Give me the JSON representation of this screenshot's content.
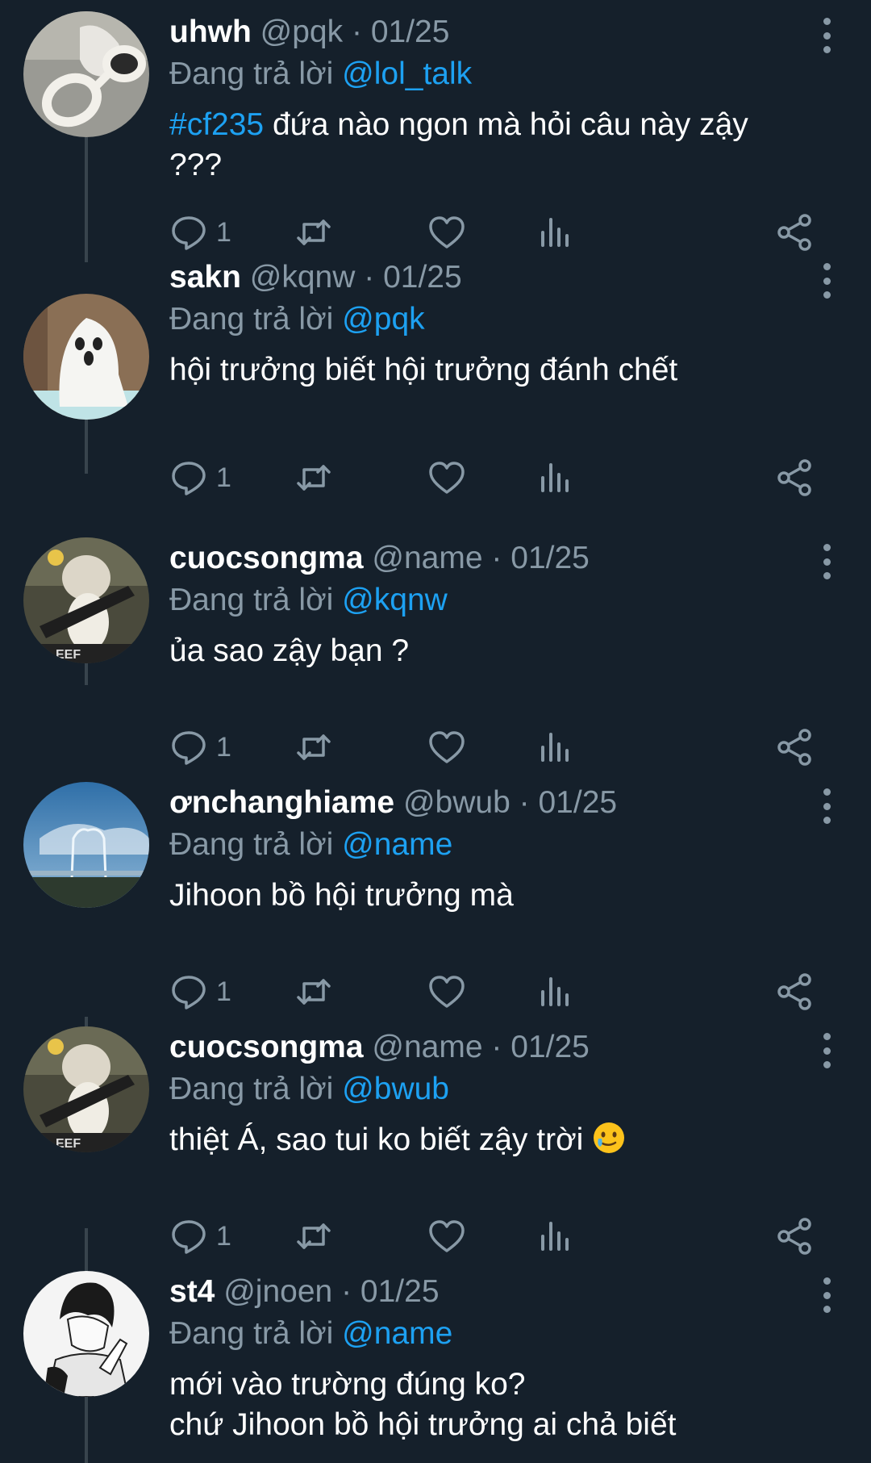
{
  "reply_prefix": "Đang trả lời",
  "separator": "·",
  "tweets": [
    {
      "name": "uhwh",
      "handle": "@pqk",
      "date": "01/25",
      "reply_to": "@lol_talk",
      "hashtag": "#cf235",
      "text": " đứa nào ngon mà hỏi câu này zậy ???",
      "reply_count": "1",
      "avatar": "glasses-avatar"
    },
    {
      "name": "sakn",
      "handle": "@kqnw",
      "date": "01/25",
      "reply_to": "@pqk",
      "text": "hội trưởng biết hội trưởng đánh chết",
      "reply_count": "1",
      "avatar": "ghost-avatar"
    },
    {
      "name": "cuocsongma",
      "handle": "@name",
      "date": "01/25",
      "reply_to": "@kqnw",
      "text": "ủa sao zậy bạn ?",
      "reply_count": "1",
      "avatar": "cat-gun-avatar"
    },
    {
      "name": "ơnchanghiame",
      "handle": "@bwub",
      "date": "01/25",
      "reply_to": "@name",
      "text": "Jihoon bồ hội trưởng mà",
      "reply_count": "1",
      "avatar": "sky-cat-avatar"
    },
    {
      "name": "cuocsongma",
      "handle": "@name",
      "date": "01/25",
      "reply_to": "@bwub",
      "text": "thiệt Á, sao tui ko biết zậy trời",
      "emoji": "crying-smile-emoji",
      "reply_count": "1",
      "avatar": "cat-gun-avatar"
    },
    {
      "name": "st4",
      "handle": "@jnoen",
      "date": "01/25",
      "reply_to": "@name",
      "text_line1": "mới vào trường đúng ko?",
      "text_line2": "chứ Jihoon bồ hội trưởng ai chả biết",
      "avatar": "manga-boy-avatar"
    }
  ],
  "colors": {
    "background": "#15202b",
    "muted": "#8899a6",
    "accent": "#1da1f2",
    "thread_line": "#38444d"
  }
}
